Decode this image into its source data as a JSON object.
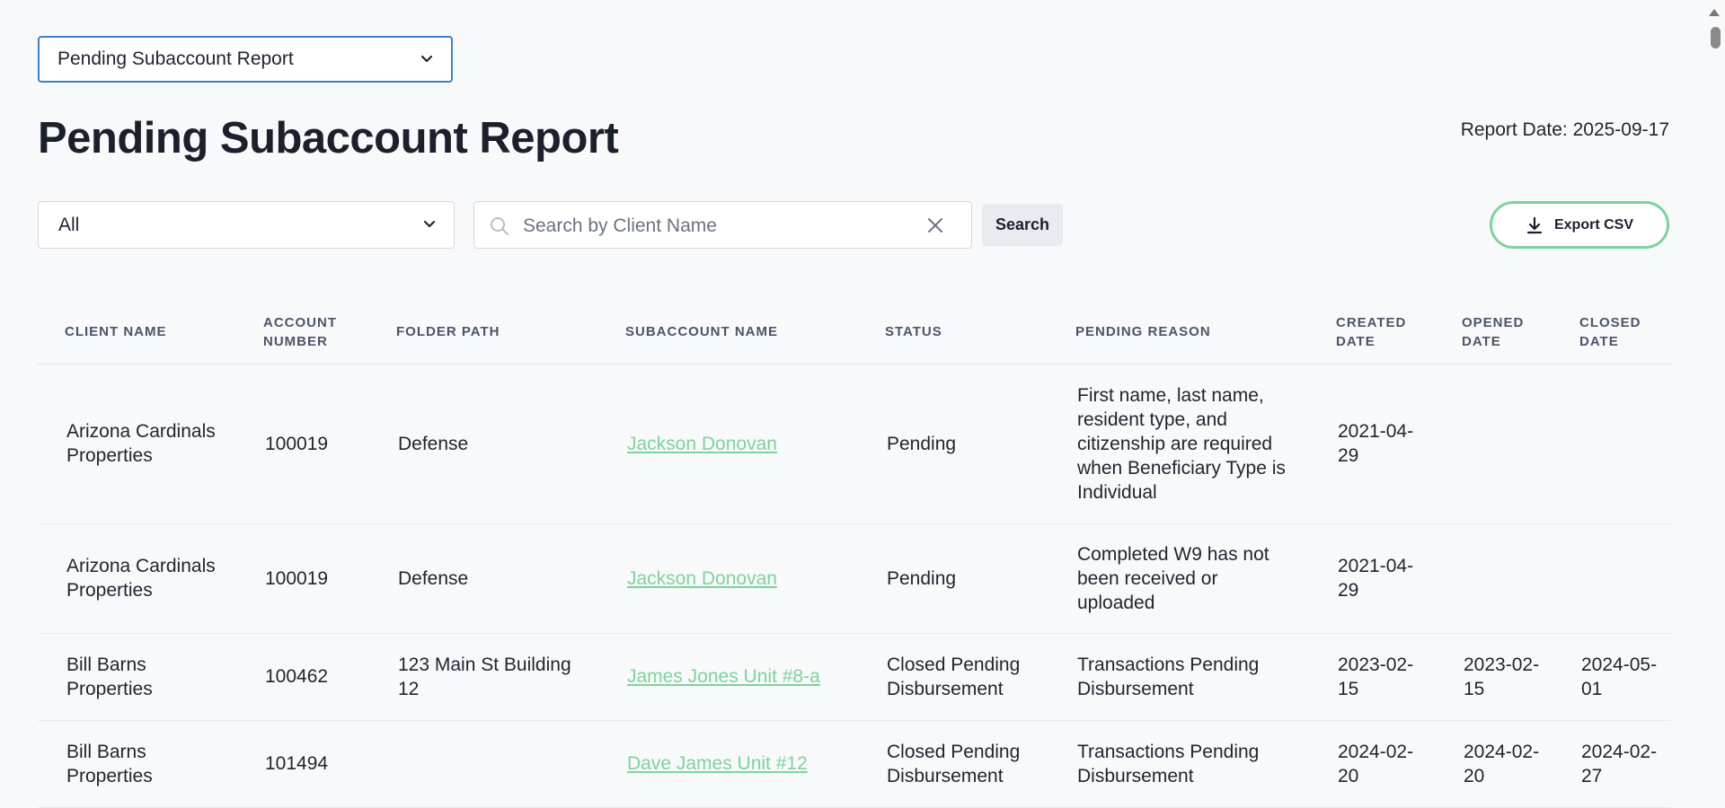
{
  "report_selector": {
    "value": "Pending Subaccount Report"
  },
  "page": {
    "title": "Pending Subaccount Report",
    "report_date": "Report Date: 2025-09-17"
  },
  "filters": {
    "status_select": "All",
    "search_placeholder": "Search by Client Name",
    "search_value": "",
    "search_button": "Search",
    "export_button": "Export CSV"
  },
  "table": {
    "headers": {
      "client_name": "CLIENT NAME",
      "account_number": "ACCOUNT NUMBER",
      "folder_path": "FOLDER PATH",
      "subaccount_name": "SUBACCOUNT NAME",
      "status": "STATUS",
      "pending_reason": "PENDING REASON",
      "created_date": "CREATED DATE",
      "opened_date": "OPENED DATE",
      "closed_date": "CLOSED DATE"
    },
    "rows": [
      {
        "client_name": "Arizona Cardinals Properties",
        "account_number": "100019",
        "folder_path": "Defense",
        "subaccount_name": "Jackson Donovan",
        "status": "Pending",
        "pending_reason": "First name, last name, resident type, and citizenship are required when Beneficiary Type is Individual",
        "created_date": "2021-04-29",
        "opened_date": "",
        "closed_date": ""
      },
      {
        "client_name": "Arizona Cardinals Properties",
        "account_number": "100019",
        "folder_path": "Defense",
        "subaccount_name": "Jackson Donovan",
        "status": "Pending",
        "pending_reason": "Completed W9 has not been received or uploaded",
        "created_date": "2021-04-29",
        "opened_date": "",
        "closed_date": ""
      },
      {
        "client_name": "Bill Barns Properties",
        "account_number": "100462",
        "folder_path": "123 Main St Building 12",
        "subaccount_name": "James Jones Unit #8-a",
        "status": "Closed Pending Disbursement",
        "pending_reason": "Transactions Pending Disbursement",
        "created_date": "2023-02-15",
        "opened_date": "2023-02-15",
        "closed_date": "2024-05-01"
      },
      {
        "client_name": "Bill Barns Properties",
        "account_number": "101494",
        "folder_path": "",
        "subaccount_name": "Dave James Unit #12",
        "status": "Closed Pending Disbursement",
        "pending_reason": "Transactions Pending Disbursement",
        "created_date": "2024-02-20",
        "opened_date": "2024-02-20",
        "closed_date": "2024-02-27"
      }
    ]
  },
  "colors": {
    "link": "#7fd29c",
    "focus_border": "#3b82c4",
    "export_border": "#7fd29c"
  },
  "icons": [
    "chevron-down-icon",
    "search-icon",
    "clear-icon",
    "download-icon"
  ]
}
